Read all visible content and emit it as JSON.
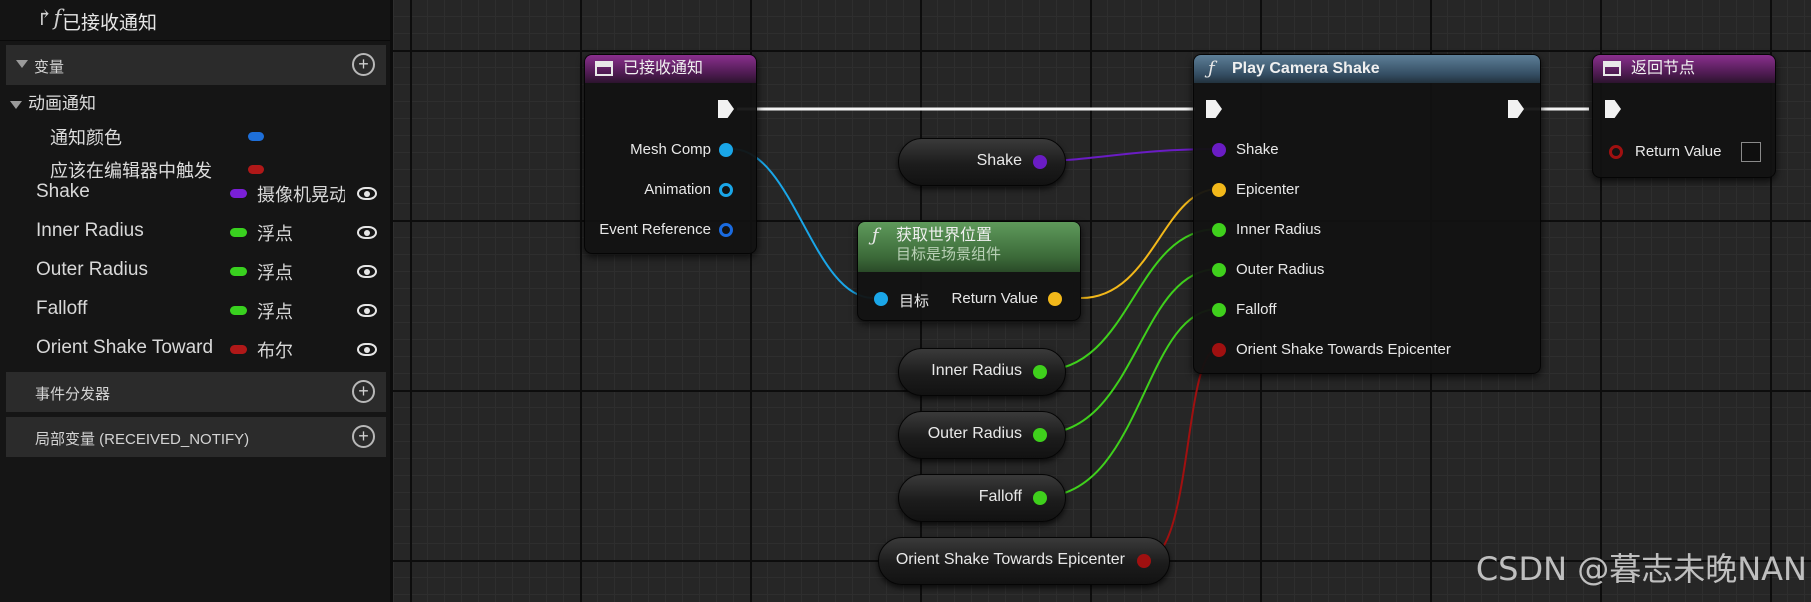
{
  "left_panel": {
    "title": "已接收通知",
    "title_icon": "function-override-icon",
    "variables_section": "变量",
    "category": "动画通知",
    "sub_items": [
      {
        "label": "通知颜色",
        "color": "#1e6fd9"
      },
      {
        "label": "应该在编辑器中触发",
        "color": "#b01818"
      }
    ],
    "variables": [
      {
        "name": "Shake",
        "type": "摄像机晃动",
        "color": "#7a1fd6"
      },
      {
        "name": "Inner Radius",
        "type": "浮点",
        "color": "#39d11f"
      },
      {
        "name": "Outer Radius",
        "type": "浮点",
        "color": "#39d11f"
      },
      {
        "name": "Falloff",
        "type": "浮点",
        "color": "#39d11f"
      },
      {
        "name": "Orient Shake Toward",
        "type": "布尔",
        "color": "#b01818"
      }
    ],
    "dispatchers_section": "事件分发器",
    "locals_section": "局部变量 (RECEIVED_NOTIFY)"
  },
  "graph": {
    "entry_node": {
      "title": "已接收通知",
      "pins": [
        "Mesh Comp",
        "Animation",
        "Event Reference"
      ]
    },
    "get_world_location": {
      "title": "获取世界位置",
      "subtitle": "目标是场景组件",
      "input_pin": "目标",
      "output_pin": "Return Value"
    },
    "play_camera_shake": {
      "title": "Play Camera Shake",
      "pins": [
        "Shake",
        "Epicenter",
        "Inner Radius",
        "Outer Radius",
        "Falloff",
        "Orient Shake Towards Epicenter"
      ]
    },
    "return_node": {
      "title": "返回节点",
      "pin": "Return Value"
    },
    "variable_nodes": {
      "shake": "Shake",
      "inner_radius": "Inner Radius",
      "outer_radius": "Outer Radius",
      "falloff": "Falloff",
      "orient": "Orient Shake Towards Epicenter"
    }
  },
  "colors": {
    "object_pin": "#1aa6e8",
    "shake_pin": "#6a1cc4",
    "vector_pin": "#f2b81a",
    "float_pin": "#3fd01c",
    "bool_pin": "#a01010",
    "exec_wire": "#f2f2f2"
  },
  "watermark": "CSDN @暮志未晚NAN"
}
